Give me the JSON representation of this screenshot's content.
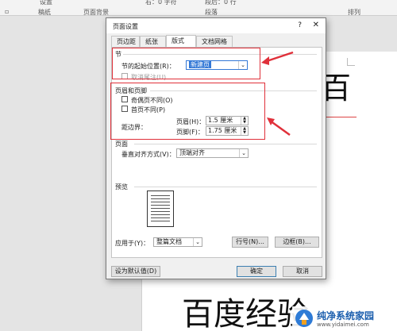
{
  "ribbon": {
    "group1": "设置",
    "group2": "稿纸",
    "group3": "页面背景",
    "group4": "段落",
    "group5": "排列",
    "right_value": "右：0 字符",
    "after_value": "段后：0 行"
  },
  "doc": {
    "right_char": "百",
    "bottom_text": "百度经验"
  },
  "dialog": {
    "title": "页面设置",
    "help": "?",
    "close": "✕",
    "tabs": [
      "页边距",
      "纸张",
      "版式",
      "文档网格"
    ],
    "section": {
      "header": "节",
      "start_label": "节的起始位置(R)：",
      "start_value": "新建页",
      "suppress_label": "取消尾注(U)"
    },
    "hf": {
      "header": "页眉和页脚",
      "odd_even_label": "奇偶页不同(O)",
      "first_page_label": "首页不同(P)",
      "margin_label": "距边界：",
      "header_label": "页眉(H)：",
      "header_value": "1.5 厘米",
      "footer_label": "页脚(F)：",
      "footer_value": "1.75 厘米"
    },
    "page": {
      "header": "页面",
      "valign_label": "垂直对齐方式(V)：",
      "valign_value": "顶端对齐"
    },
    "preview": {
      "header": "预览",
      "apply_label": "应用于(Y)：",
      "apply_value": "整篇文档",
      "line_numbers": "行号(N)...",
      "borders": "边框(B)..."
    },
    "footer": {
      "default": "设为默认值(D)",
      "ok": "确定",
      "cancel": "取消"
    }
  },
  "watermark": {
    "text": "纯净系统家园",
    "url": "www.yidaimei.com"
  },
  "colors": {
    "annotation": "#e0303a",
    "select_highlight": "#3378d6"
  }
}
